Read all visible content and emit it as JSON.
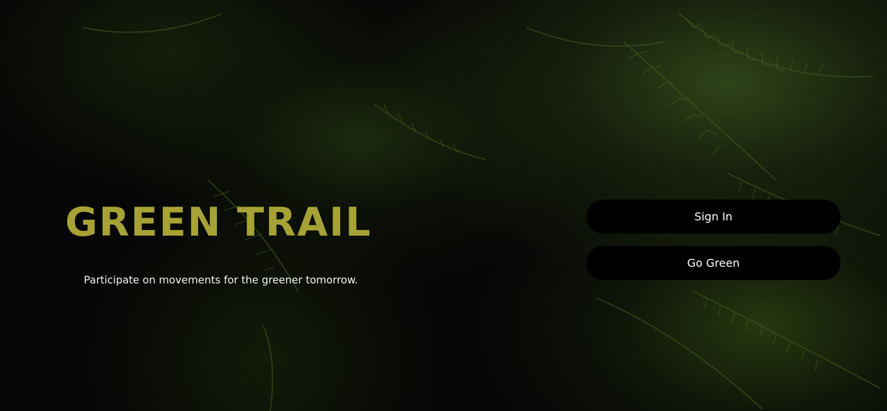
{
  "hero": {
    "title": "GREEN TRAIL",
    "tagline": "Participate on movements for the greener tomorrow.",
    "title_color": "#a7a235",
    "background_color": "#060606",
    "background_image": "dark-fern-leaves"
  },
  "actions": {
    "sign_in_label": "Sign In",
    "go_green_label": "Go Green",
    "button_color": "#000000"
  }
}
